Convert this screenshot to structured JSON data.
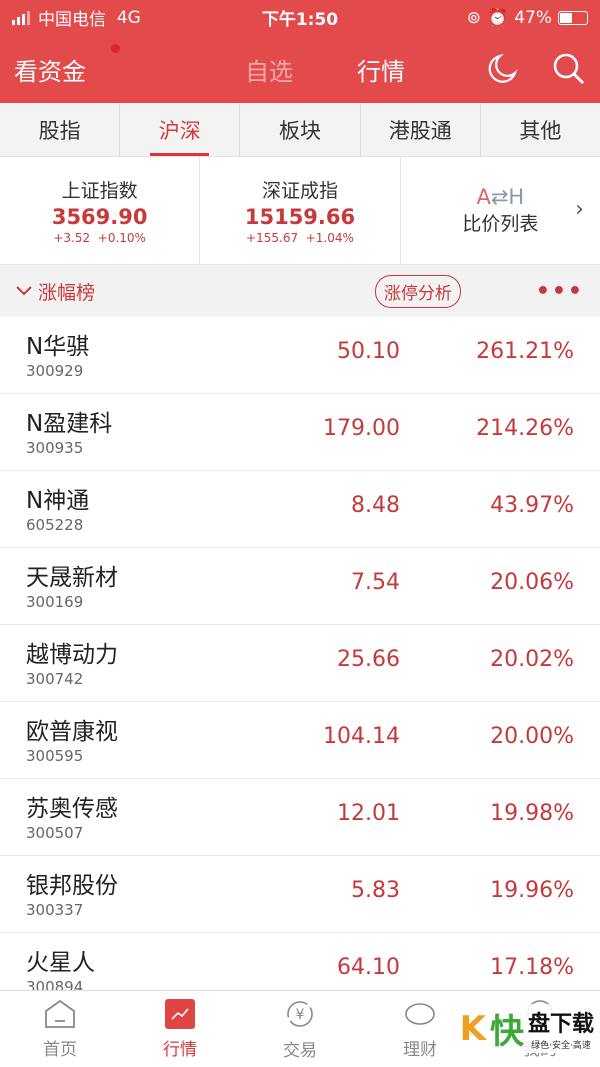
{
  "status": {
    "carrier": "中国电信",
    "network": "4G",
    "time": "下午1:50",
    "battery": "47%",
    "battery_level": 0.47
  },
  "header": {
    "brand": "看资金",
    "tabs": [
      "自选",
      "行情"
    ],
    "active_tab": "行情",
    "icons": [
      "moon-icon",
      "search-icon"
    ]
  },
  "tabs": [
    {
      "label": "股指"
    },
    {
      "label": "沪深",
      "active": true
    },
    {
      "label": "板块"
    },
    {
      "label": "港股通"
    },
    {
      "label": "其他"
    }
  ],
  "indices": [
    {
      "name": "上证指数",
      "value": "3569.90",
      "change": "+3.52",
      "pct": "+0.10%"
    },
    {
      "name": "深证成指",
      "value": "15159.66",
      "change": "+155.67",
      "pct": "+1.04%"
    }
  ],
  "ah": {
    "logo_a": "A",
    "logo_h": "⇄H",
    "label": "比价列表"
  },
  "section": {
    "title": "涨幅榜",
    "button": "涨停分析",
    "more": "•••"
  },
  "stocks": [
    {
      "name": "N华骐",
      "code": "300929",
      "price": "50.10",
      "pct": "261.21%"
    },
    {
      "name": "N盈建科",
      "code": "300935",
      "price": "179.00",
      "pct": "214.26%"
    },
    {
      "name": "N神通",
      "code": "605228",
      "price": "8.48",
      "pct": "43.97%"
    },
    {
      "name": "天晟新材",
      "code": "300169",
      "price": "7.54",
      "pct": "20.06%"
    },
    {
      "name": "越博动力",
      "code": "300742",
      "price": "25.66",
      "pct": "20.02%"
    },
    {
      "name": "欧普康视",
      "code": "300595",
      "price": "104.14",
      "pct": "20.00%"
    },
    {
      "name": "苏奥传感",
      "code": "300507",
      "price": "12.01",
      "pct": "19.98%"
    },
    {
      "name": "银邦股份",
      "code": "300337",
      "price": "5.83",
      "pct": "19.96%"
    },
    {
      "name": "火星人",
      "code": "300894",
      "price": "64.10",
      "pct": "17.18%"
    }
  ],
  "nav": [
    {
      "label": "首页",
      "icon": "home-icon"
    },
    {
      "label": "行情",
      "icon": "chart-icon",
      "active": true
    },
    {
      "label": "交易",
      "icon": "yuan-icon"
    },
    {
      "label": "理财",
      "icon": "piggy-icon"
    },
    {
      "label": "我的",
      "icon": "user-icon"
    }
  ],
  "watermark": {
    "k": "K",
    "a": "快",
    "b": "盘下载",
    "sub": "绿色·安全·高速"
  },
  "colors": {
    "brand": "#e24a4b",
    "accent": "#d9383a",
    "up": "#c43a3c"
  }
}
